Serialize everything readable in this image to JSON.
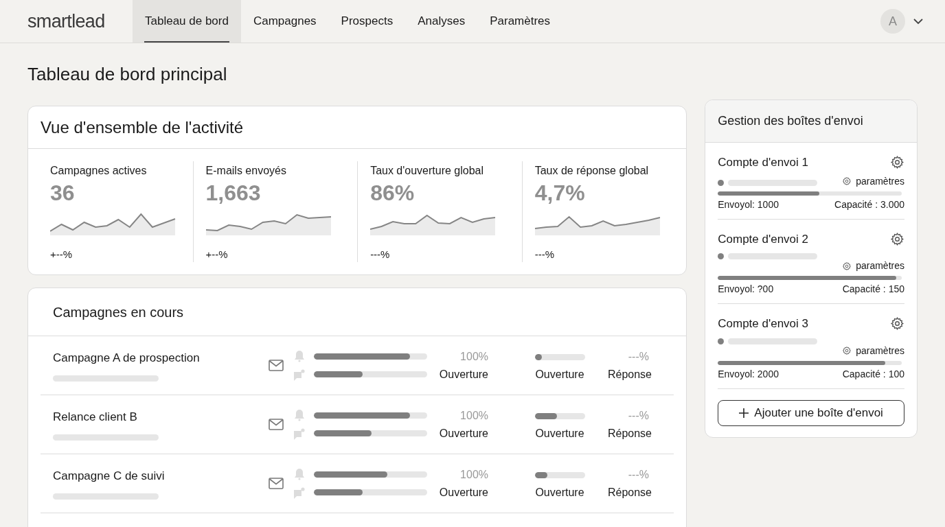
{
  "nav": {
    "logo": "smartlead",
    "tabs": [
      {
        "label": "Tableau de bord",
        "selected": true
      },
      {
        "label": "Campagnes",
        "selected": false
      },
      {
        "label": "Prospects",
        "selected": false
      },
      {
        "label": "Analyses",
        "selected": false
      },
      {
        "label": "Paramètres",
        "selected": false
      }
    ],
    "avatar": "A"
  },
  "page_title": "Tableau de bord principal",
  "overview": {
    "title": "Vue d'ensemble de l'activité",
    "stats": [
      {
        "label": "Campagnes actives",
        "value": "36",
        "change": "+--%"
      },
      {
        "label": "E-mails envoyés",
        "value": "1,663",
        "change": "+--%"
      },
      {
        "label": "Taux d'ouverture global",
        "value": "86%",
        "change": "---%"
      },
      {
        "label": "Taux de réponse global",
        "value": "4,7%",
        "change": "---%"
      }
    ]
  },
  "campaigns": {
    "title": "Campagnes en cours",
    "rows": [
      {
        "name": "Campagne A de prospection",
        "bar_1": {
          "level": 0.85
        },
        "bar_2": {
          "level": 0.43
        },
        "open_rate": "100%",
        "open_label": "Ouverture",
        "bar_3": {
          "level": 0.15
        },
        "open_label_2": "Ouverture",
        "reply_rate": "---%",
        "reply_label": "Réponse"
      },
      {
        "name": "Relance client B",
        "bar_1": {
          "level": 0.85
        },
        "bar_2": {
          "level": 0.51
        },
        "open_rate": "100%",
        "open_label": "Ouverture",
        "bar_3": {
          "level": 0.45
        },
        "open_label_2": "Ouverture",
        "reply_rate": "---%",
        "reply_label": "Réponse"
      },
      {
        "name": "Campagne C de suivi",
        "bar_1": {
          "level": 0.65
        },
        "bar_2": {
          "level": 0.43
        },
        "open_rate": "100%",
        "open_label": "Ouverture",
        "bar_3": {
          "level": 0.25
        },
        "open_label_2": "Ouverture",
        "reply_rate": "---%",
        "reply_label": "Réponse"
      }
    ]
  },
  "mailboxes": {
    "title": "Gestion des boîtes d'envoi",
    "accounts": [
      {
        "name": "Compte d'envoi 1",
        "settings": "paramètres",
        "level": 0.55,
        "sent": "Envoyol: 1000",
        "capacity": "Capacité : 3.000"
      },
      {
        "name": "Compte d'envoi 2",
        "settings": "paramètres",
        "level": 0.97,
        "sent": "Envoyol: ?00",
        "capacity": "Capacité : 150"
      },
      {
        "name": "Compte d'envoi 3",
        "settings": "paramètres",
        "level": 0.91,
        "sent": "Envoyol: 2000",
        "capacity": "Capacité : 100"
      }
    ],
    "add_button": "Ajouter une boîte d'envoi"
  }
}
